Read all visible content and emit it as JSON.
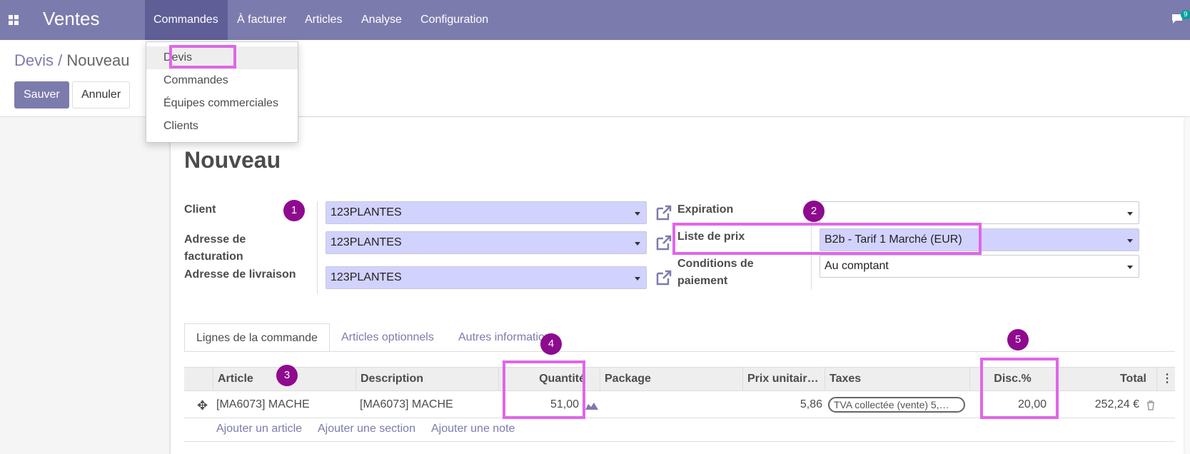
{
  "nav": {
    "app_title": "Ventes",
    "menu": [
      "Commandes",
      "À facturer",
      "Articles",
      "Analyse",
      "Configuration"
    ],
    "chat_badge": "9"
  },
  "dropdown": {
    "items": [
      "Devis",
      "Commandes",
      "Équipes commerciales",
      "Clients"
    ]
  },
  "breadcrumb": {
    "parent": "Devis",
    "sep": " / ",
    "current": "Nouveau"
  },
  "buttons": {
    "save": "Sauver",
    "cancel": "Annuler"
  },
  "form": {
    "title": "Nouveau",
    "client_label": "Client",
    "client_value": "123PLANTES",
    "invoice_label": "Adresse de facturation",
    "invoice_value": "123PLANTES",
    "delivery_label": "Adresse de livraison",
    "delivery_value": "123PLANTES",
    "expiration_label": "Expiration",
    "expiration_value": "",
    "pricelist_label": "Liste de prix",
    "pricelist_value": "B2b - Tarif 1 Marché (EUR)",
    "payment_label": "Conditions de paiement",
    "payment_value": "Au comptant"
  },
  "tabs": [
    "Lignes de la commande",
    "Articles optionnels",
    "Autres informations"
  ],
  "table": {
    "headers": {
      "article": "Article",
      "description": "Description",
      "quantity": "Quantité",
      "package": "Package",
      "price": "Prix unitair…",
      "taxes": "Taxes",
      "discount": "Disc.%",
      "total": "Total"
    },
    "row": {
      "article": "[MA6073] MACHE",
      "description": "[MA6073] MACHE",
      "quantity": "51,00",
      "package": "",
      "price": "5,86",
      "taxes": "TVA collectée (vente) 5,…",
      "discount": "20,00",
      "total": "252,24 €"
    },
    "actions": [
      "Ajouter un article",
      "Ajouter une section",
      "Ajouter une note"
    ]
  },
  "markers": [
    "1",
    "2",
    "3",
    "4",
    "5"
  ],
  "colors": {
    "brand": "#7c7bad",
    "highlight": "#e066e8",
    "marker": "#8e0a8e",
    "required_field": "#d2d2ff"
  }
}
